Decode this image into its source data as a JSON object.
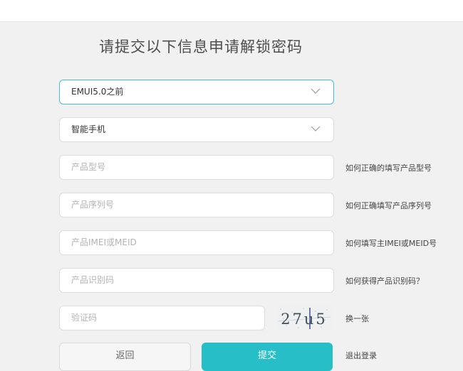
{
  "title": "请提交以下信息申请解锁密码",
  "fields": {
    "system_version": {
      "value": "EMUI5.0之前"
    },
    "device_type": {
      "value": "智能手机"
    },
    "product_model": {
      "placeholder": "产品型号",
      "help": "如何正确的填写产品型号"
    },
    "serial_number": {
      "placeholder": "产品序列号",
      "help": "如何正确填写产品序列号"
    },
    "imei": {
      "placeholder": "产品IMEI或MEID",
      "help": "如何填写主IMEI或MEID号"
    },
    "product_id": {
      "placeholder": "产品识别码",
      "help": "如何获得产品识别码？"
    },
    "captcha": {
      "placeholder": "验证码",
      "image_text": "27u5",
      "refresh_label": "换一张"
    }
  },
  "buttons": {
    "back": "返回",
    "submit": "提交",
    "logout": "退出登录"
  },
  "colors": {
    "accent": "#26bfc8",
    "focus_border": "#4ab8d6"
  }
}
